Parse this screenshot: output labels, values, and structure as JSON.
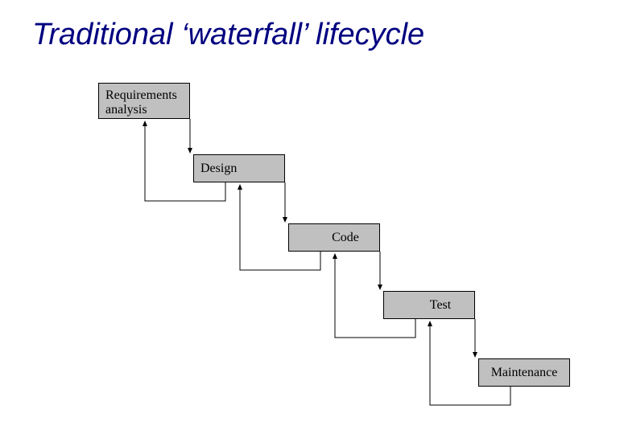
{
  "title": "Traditional ‘waterfall’ lifecycle",
  "stages": {
    "requirements": "Requirements analysis",
    "design": "Design",
    "code": "Code",
    "test": "Test",
    "maintenance": "Maintenance"
  }
}
